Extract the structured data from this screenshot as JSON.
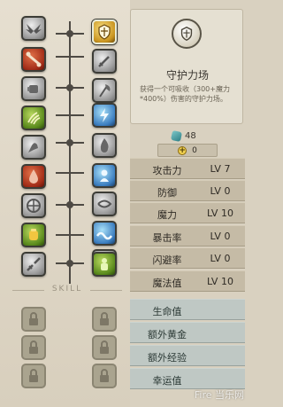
{
  "skill_panel": {
    "selected_icon": "shield-icon",
    "title": "守护力场",
    "description": "获得一个可吸收（300+魔力*400%）伤害的守护力场。"
  },
  "currency": {
    "icon": "gem-icon",
    "value": "48"
  },
  "skill_points": {
    "icon": "plus-icon",
    "value": "0"
  },
  "tree_section_label": "SKILL",
  "stats": [
    {
      "name": "攻击力",
      "level": "LV 7",
      "locked": false
    },
    {
      "name": "防御",
      "level": "LV 0",
      "locked": false
    },
    {
      "name": "魔力",
      "level": "LV 10",
      "locked": false
    },
    {
      "name": "暴击率",
      "level": "LV 0",
      "locked": false
    },
    {
      "name": "闪避率",
      "level": "LV 0",
      "locked": false
    },
    {
      "name": "魔法值",
      "level": "LV 10",
      "locked": false
    },
    {
      "name": "生命值",
      "level": "",
      "locked": true
    },
    {
      "name": "额外黄金",
      "level": "",
      "locked": true
    },
    {
      "name": "额外经验",
      "level": "",
      "locked": true
    },
    {
      "name": "幸运值",
      "level": "",
      "locked": true
    }
  ],
  "left_skills": [
    {
      "icon": "wings-icon",
      "color": "grey"
    },
    {
      "icon": "bone-icon",
      "color": "red"
    },
    {
      "icon": "fist-icon",
      "color": "grey"
    },
    {
      "icon": "claw-icon",
      "color": "green"
    },
    {
      "icon": "flex-arm-icon",
      "color": "grey"
    },
    {
      "icon": "blood-drop-icon",
      "color": "red"
    },
    {
      "icon": "wheel-icon",
      "color": "grey"
    },
    {
      "icon": "golden-fist-icon",
      "color": "green"
    },
    {
      "icon": "broken-sword-icon",
      "color": "grey"
    }
  ],
  "right_skills": [
    {
      "icon": "shield-icon",
      "color": "gold",
      "selected": true
    },
    {
      "icon": "sword-icon",
      "color": "grey"
    },
    {
      "icon": "axe-icon",
      "color": "grey"
    },
    {
      "icon": "lightning-icon",
      "color": "blue"
    },
    {
      "icon": "flame-icon",
      "color": "grey"
    },
    {
      "icon": "spirit-icon",
      "color": "blue"
    },
    {
      "icon": "storm-icon",
      "color": "grey"
    },
    {
      "icon": "wave-icon",
      "color": "blue"
    },
    {
      "icon": "phantom-icon",
      "color": "grey"
    },
    {
      "icon": "golem-icon",
      "color": "green"
    }
  ],
  "locked_icon": "lock-icon",
  "watermark": "Fire 当乐网"
}
